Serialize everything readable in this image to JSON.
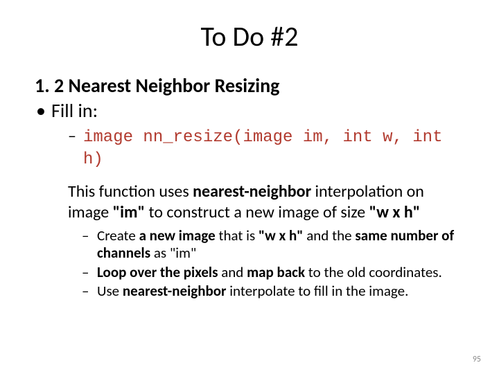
{
  "title": "To Do #2",
  "subtitle": "1. 2 Nearest Neighbor Resizing",
  "fill_in": "Fill in:",
  "code_sig": "image nn_resize(image im, int w, int h)",
  "desc_a": "This function uses ",
  "desc_b": "nearest-neighbor",
  "desc_c": " interpolation on image ",
  "desc_d": "\"im\"",
  "desc_e": " to construct a new image of size ",
  "desc_f": "\"w x h\"",
  "step1_a": "Create ",
  "step1_b": "a new image ",
  "step1_c": "that is ",
  "step1_d": "\"w x h\" ",
  "step1_e": "and the ",
  "step1_f": "same number of channels ",
  "step1_g": "as \"im\"",
  "step2_a": "Loop over the pixels ",
  "step2_b": "and ",
  "step2_c": "map back ",
  "step2_d": "to the old coordinates.",
  "step3_a": " Use ",
  "step3_b": "nearest-neighbor ",
  "step3_c": "interpolate to fill in the image.",
  "page_number": "95"
}
